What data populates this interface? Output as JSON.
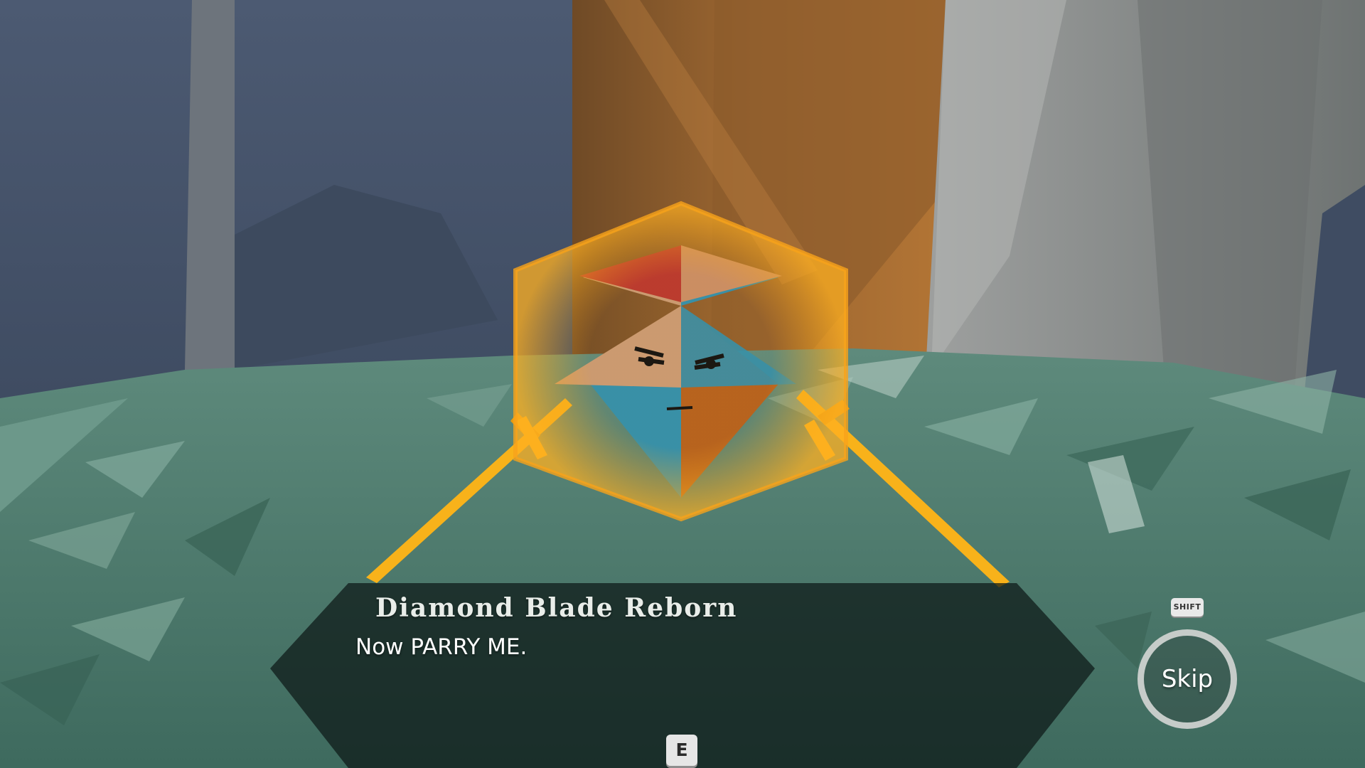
{
  "dialogue": {
    "speaker": "Diamond Blade Reborn",
    "text": "Now PARRY ME.",
    "advance_key": "E"
  },
  "skip": {
    "key_hint": "SHIFT",
    "label": "Skip"
  },
  "colors": {
    "shield_orange": "#f7a21a",
    "sword_gold": "#f8b21a",
    "grass": "#4e7a6c",
    "wall_blue": "#4a5870",
    "pillar_brown": "#a0672c",
    "rock_grey": "#8d9090"
  }
}
